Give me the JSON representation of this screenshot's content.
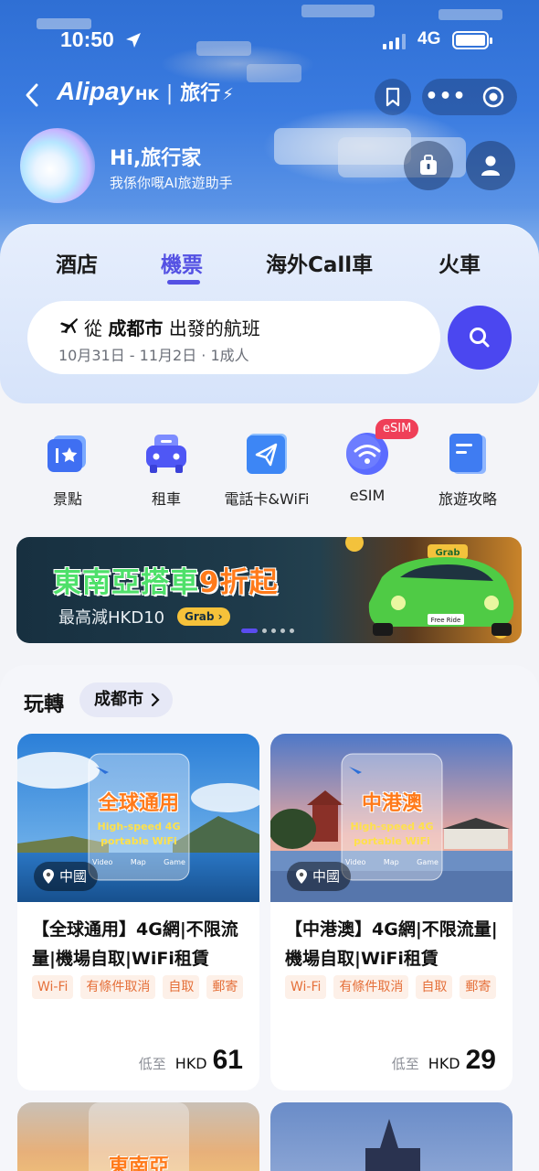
{
  "status_bar": {
    "time": "10:50",
    "network": "4G"
  },
  "nav": {
    "brand": "Alipay",
    "brand_suffix": "HK",
    "section": "旅行"
  },
  "greeting": {
    "title": "Hi,旅行家",
    "subtitle": "我係你嘅AI旅遊助手"
  },
  "tabs": [
    {
      "label": "酒店"
    },
    {
      "label": "機票",
      "active": true
    },
    {
      "label": "海外Call車"
    },
    {
      "label": "火車"
    }
  ],
  "search": {
    "prefix": "從",
    "city": "成都市",
    "suffix": "出發的航班",
    "details": "10月31日 - 11月2日 · 1成人"
  },
  "quick_links": [
    {
      "label": "景點",
      "icon": "attraction-ticket-icon"
    },
    {
      "label": "租車",
      "icon": "car-rental-icon"
    },
    {
      "label": "電話卡&WiFi",
      "icon": "sim-wifi-icon"
    },
    {
      "label": "eSIM",
      "icon": "esim-wifi-icon",
      "badge": "eSIM"
    },
    {
      "label": "旅遊攻略",
      "icon": "travel-guide-icon"
    }
  ],
  "banner": {
    "title_part1": "東南亞搭車",
    "title_part2": "9折起",
    "subtitle": "最高減HKD10",
    "pill": "Grab",
    "car_plate": "Free Ride",
    "sign": "Grab"
  },
  "section": {
    "title": "玩轉",
    "city": "成都市"
  },
  "cards": [
    {
      "image_text": "全球通用",
      "image_sub": "High-speed 4G portable WiFi",
      "image_meta": [
        "Video",
        "Map",
        "Game"
      ],
      "location": "中國",
      "title": "【全球通用】4G網|不限流量|機場自取|WiFi租賃",
      "tags": [
        "Wi-Fi",
        "有條件取消",
        "自取",
        "郵寄"
      ],
      "price_prefix": "低至",
      "currency": "HKD",
      "price": "61"
    },
    {
      "image_text": "中港澳",
      "image_sub": "High-speed 4G portable WiFi",
      "image_meta": [
        "Video",
        "Map",
        "Game"
      ],
      "location": "中國",
      "title": "【中港澳】4G網|不限流量|機場自取|WiFi租賃",
      "tags": [
        "Wi-Fi",
        "有條件取消",
        "自取",
        "郵寄"
      ],
      "price_prefix": "低至",
      "currency": "HKD",
      "price": "29"
    }
  ],
  "partial_cards": [
    {
      "image_text": "東南亞"
    },
    {
      "image_text": ""
    }
  ],
  "colors": {
    "accent": "#4b47f0",
    "tab_active": "#5451e3",
    "tag_text": "#e5703a",
    "tag_bg": "#fdf0e8",
    "badge": "#ef3f58",
    "banner_green": "#4ee06a",
    "banner_orange": "#ff7a1a"
  }
}
